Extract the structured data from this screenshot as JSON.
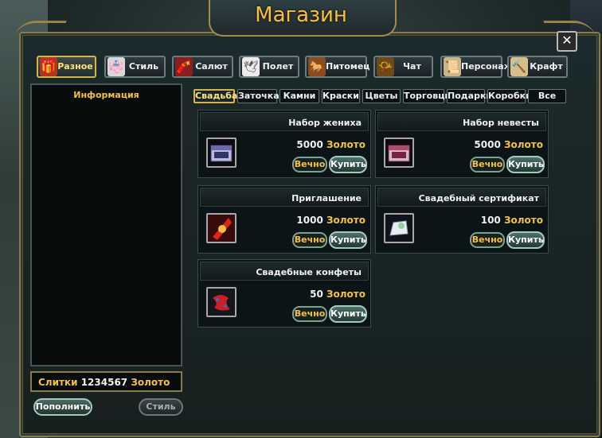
{
  "window": {
    "title": "Магазин"
  },
  "categories": [
    {
      "label": "Разное",
      "icon": "gift-icon",
      "active": true
    },
    {
      "label": "Стиль",
      "icon": "outfit-icon",
      "active": false
    },
    {
      "label": "Салют",
      "icon": "firework-icon",
      "active": false
    },
    {
      "label": "Полет",
      "icon": "wings-icon",
      "active": false
    },
    {
      "label": "Питомец",
      "icon": "pet-icon",
      "active": false
    },
    {
      "label": "Чат",
      "icon": "horn-icon",
      "active": false
    },
    {
      "label": "Персонаж",
      "icon": "scroll-icon",
      "active": false
    },
    {
      "label": "Крафт",
      "icon": "hammer-icon",
      "active": false
    }
  ],
  "info_panel": {
    "title": "Информация"
  },
  "balance": {
    "label": "Слитки",
    "amount": "1234567",
    "currency": "Золото"
  },
  "left_buttons": {
    "topup": "Пополнить",
    "style": "Стиль"
  },
  "subtabs": [
    {
      "label": "Свадьба",
      "active": true
    },
    {
      "label": "Заточка"
    },
    {
      "label": "Камни"
    },
    {
      "label": "Краски"
    },
    {
      "label": "Цветы"
    },
    {
      "label": "Торговцы"
    },
    {
      "label": "Подарки"
    },
    {
      "label": "Коробки"
    },
    {
      "label": "Все"
    }
  ],
  "items": [
    {
      "name": "Набор жениха",
      "price": "5000",
      "currency": "Золото",
      "forever": "Вечно",
      "buy": "Купить",
      "icon": "groom-box-icon"
    },
    {
      "name": "Набор невесты",
      "price": "5000",
      "currency": "Золото",
      "forever": "Вечно",
      "buy": "Купить",
      "icon": "bride-box-icon"
    },
    {
      "name": "Приглашение",
      "price": "1000",
      "currency": "Золото",
      "forever": "Вечно",
      "buy": "Купить",
      "icon": "invitation-icon"
    },
    {
      "name": "Свадебный сертификат",
      "price": "100",
      "currency": "Золото",
      "forever": "Вечно",
      "buy": "Купить",
      "icon": "certificate-icon"
    },
    {
      "name": "Свадебные конфеты",
      "price": "50",
      "currency": "Золото",
      "forever": "Вечно",
      "buy": "Купить",
      "icon": "candy-icon"
    }
  ]
}
